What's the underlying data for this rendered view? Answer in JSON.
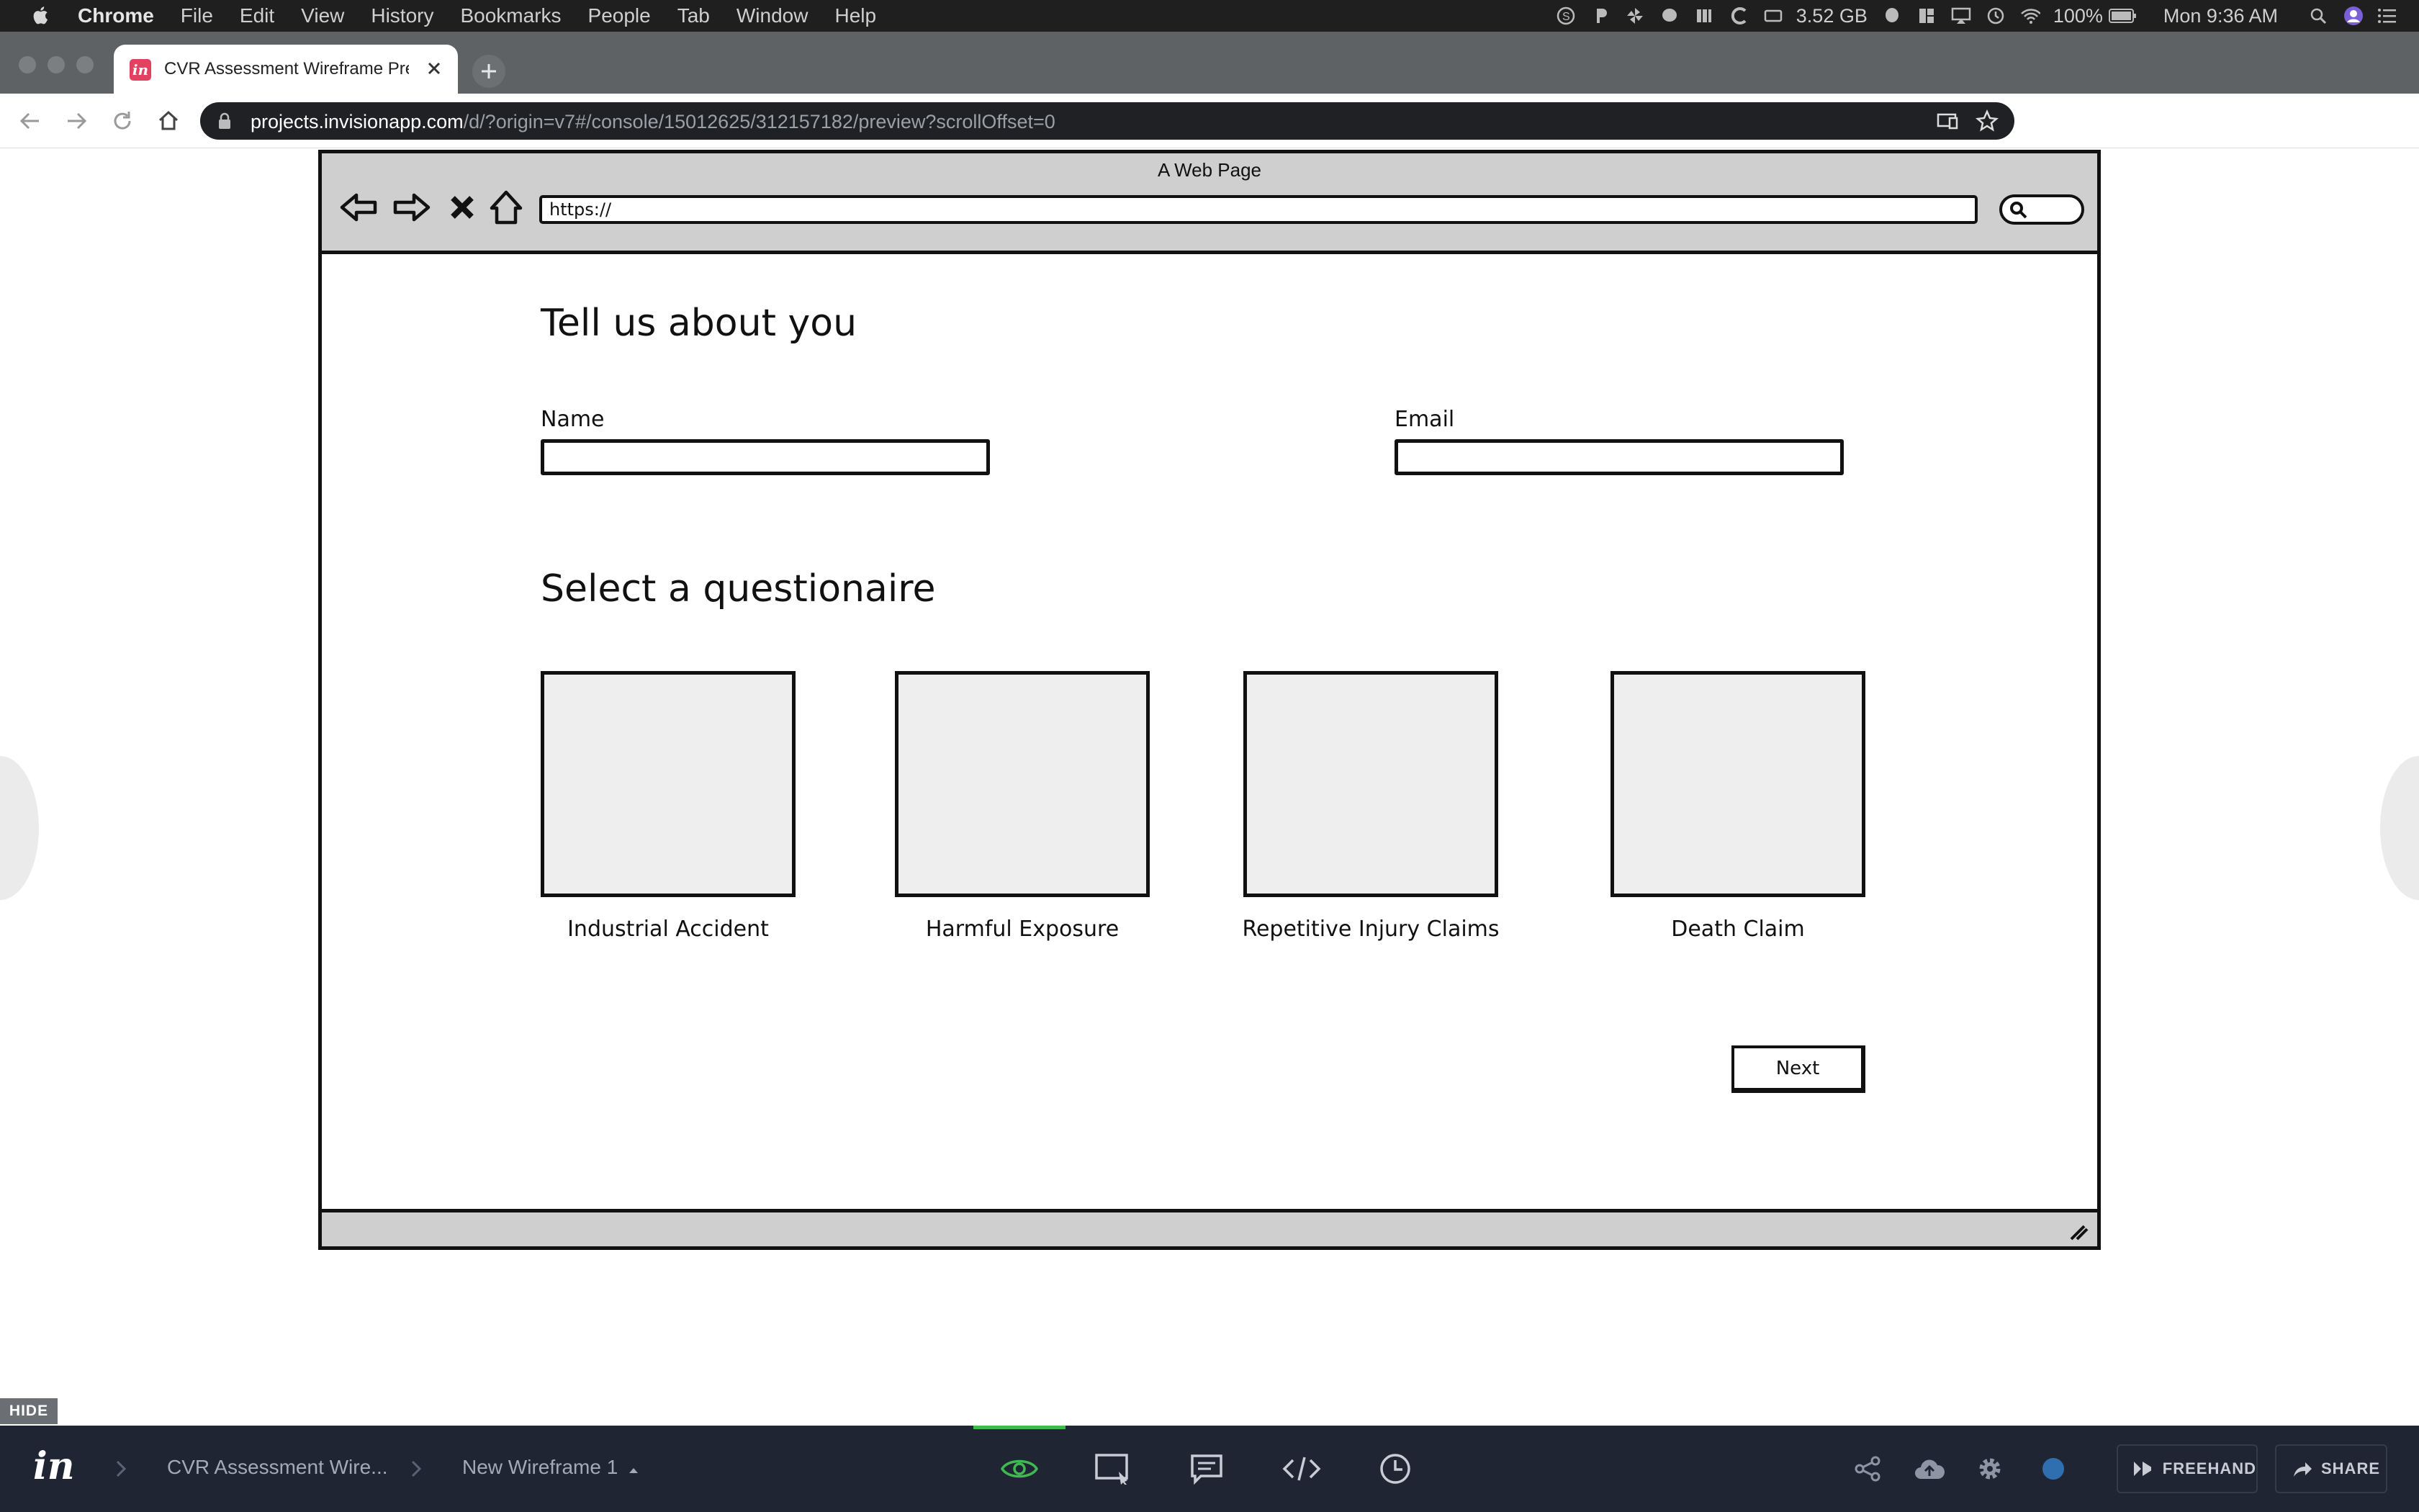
{
  "menubar": {
    "app_name": "Chrome",
    "menus": [
      "File",
      "Edit",
      "View",
      "History",
      "Bookmarks",
      "People",
      "Tab",
      "Window",
      "Help"
    ],
    "memory": "3.52 GB",
    "battery": "100%",
    "clock": "Mon 9:36 AM"
  },
  "browser": {
    "tab_title": "CVR Assessment Wireframe Pre",
    "url_host": "projects.invisionapp.com",
    "url_path": "/d/?origin=v7#/console/15012625/312157182/preview?scrollOffset=0"
  },
  "wireframe": {
    "page_title": "A Web Page",
    "address": "https://",
    "heading_about": "Tell us about you",
    "name_label": "Name",
    "email_label": "Email",
    "heading_questionnaire": "Select a questionaire",
    "cards": [
      {
        "label": "Industrial Accident"
      },
      {
        "label": "Harmful Exposure"
      },
      {
        "label": "Repetitive Injury Claims"
      },
      {
        "label": "Death Claim"
      }
    ],
    "next_label": "Next"
  },
  "invision": {
    "hide_label": "HIDE",
    "project_crumb": "CVR Assessment Wire...",
    "screen_crumb": "New Wireframe 1",
    "freehand_label": "FREEHAND",
    "share_label": "SHARE",
    "accent_color": "#3fb950",
    "bar_color": "#1f2533"
  }
}
